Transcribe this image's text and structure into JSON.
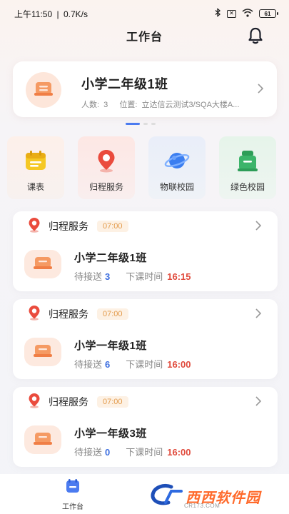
{
  "status_bar": {
    "time": "上午11:50",
    "network_speed": "0.7K/s",
    "separator": "|",
    "battery": "61"
  },
  "header": {
    "title": "工作台"
  },
  "class_card": {
    "name": "小学二年级1班",
    "count_label": "人数:",
    "count": "3",
    "location_label": "位置:",
    "location": "立达信云测试3/SQA大楼A..."
  },
  "quick_menu": [
    {
      "label": "课表",
      "icon": "calendar-icon",
      "color": "#f2c021"
    },
    {
      "label": "归程服务",
      "icon": "location-pin-icon",
      "color": "#ea4b3d"
    },
    {
      "label": "物联校园",
      "icon": "planet-icon",
      "color": "#3b7ef0"
    },
    {
      "label": "绿色校园",
      "icon": "recycle-bin-icon",
      "color": "#3cb46a"
    }
  ],
  "services": [
    {
      "title": "归程服务",
      "time": "07:00",
      "class_name": "小学二年级1班",
      "pending_label": "待接送",
      "pending": "3",
      "end_label": "下课时间",
      "end_time": "16:15"
    },
    {
      "title": "归程服务",
      "time": "07:00",
      "class_name": "小学一年级1班",
      "pending_label": "待接送",
      "pending": "6",
      "end_label": "下课时间",
      "end_time": "16:00"
    },
    {
      "title": "归程服务",
      "time": "07:00",
      "class_name": "小学一年级3班",
      "pending_label": "待接送",
      "pending": "0",
      "end_label": "下课时间",
      "end_time": "16:00"
    }
  ],
  "tabbar": {
    "work_label": "工作台"
  },
  "watermark": {
    "text": "西西软件园",
    "sub": "CR173.COM"
  },
  "colors": {
    "accent_blue": "#4b7bf0",
    "pending_blue": "#3d6fe0",
    "time_red": "#e04a3c",
    "time_badge": "#e39b4c"
  }
}
